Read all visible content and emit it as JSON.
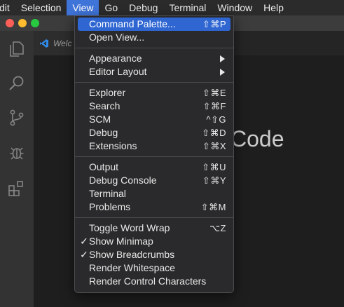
{
  "menubar": {
    "items": [
      "dit",
      "Selection",
      "View",
      "Go",
      "Debug",
      "Terminal",
      "Window",
      "Help"
    ]
  },
  "tab": {
    "label": "Welc"
  },
  "editor": {
    "partial_title": "Code"
  },
  "view_menu": {
    "groups": [
      [
        {
          "label": "Command Palette...",
          "shortcut": "⇧⌘P",
          "highlighted": true
        },
        {
          "label": "Open View...",
          "shortcut": ""
        }
      ],
      [
        {
          "label": "Appearance",
          "submenu": true
        },
        {
          "label": "Editor Layout",
          "submenu": true
        }
      ],
      [
        {
          "label": "Explorer",
          "shortcut": "⇧⌘E"
        },
        {
          "label": "Search",
          "shortcut": "⇧⌘F"
        },
        {
          "label": "SCM",
          "shortcut": "^⇧G"
        },
        {
          "label": "Debug",
          "shortcut": "⇧⌘D"
        },
        {
          "label": "Extensions",
          "shortcut": "⇧⌘X"
        }
      ],
      [
        {
          "label": "Output",
          "shortcut": "⇧⌘U"
        },
        {
          "label": "Debug Console",
          "shortcut": "⇧⌘Y"
        },
        {
          "label": "Terminal",
          "shortcut": ""
        },
        {
          "label": "Problems",
          "shortcut": "⇧⌘M"
        }
      ],
      [
        {
          "label": "Toggle Word Wrap",
          "shortcut": "⌥Z"
        },
        {
          "label": "Show Minimap",
          "checked": true
        },
        {
          "label": "Show Breadcrumbs",
          "checked": true
        },
        {
          "label": "Render Whitespace"
        },
        {
          "label": "Render Control Characters"
        }
      ]
    ]
  },
  "colors": {
    "accent": "#2f66d1",
    "menu_bg": "#2a2a2c",
    "activity_bar": "#333333"
  }
}
